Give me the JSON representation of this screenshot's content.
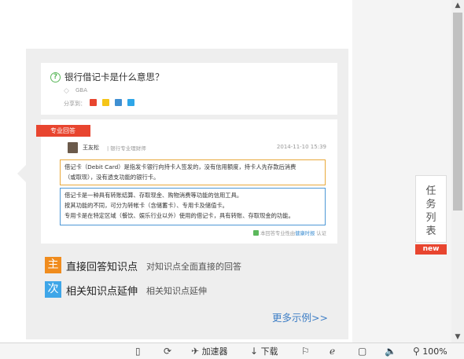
{
  "question": {
    "title": "银行借记卡是什么意思？",
    "tag": "GBA",
    "share_label": "分享到："
  },
  "answer": {
    "badge": "专业回答",
    "expert_name": "王友松",
    "expert_title": "| 银行专业理财师",
    "date": "2014-11-10  15:39",
    "orange_lines": [
      "借记卡（Debit Card）是指发卡银行向持卡人签发的，没有信用额度，持卡人先存款后消费",
      "（或取现），没有透支功能的银行卡。"
    ],
    "blue_lines": [
      "借记卡是一种具有转账结算、存取现金、购物消费等功能的信用工具。",
      "按其功能的不同，可分为转帐卡（含储蓄卡）、专用卡及储值卡。",
      "专用卡是在特定区域（餐饮、娱乐行业以外）使用的借记卡，具有转账、存取现金的功能。"
    ],
    "footer_prefix": "本回答专业性由",
    "footer_brand": "健康时报",
    "footer_suffix": "认证"
  },
  "features": [
    {
      "badge": "主",
      "title": "直接回答知识点",
      "desc": "对知识点全面直接的回答",
      "color": "#f08c1e"
    },
    {
      "badge": "次",
      "title": "相关知识点延伸",
      "desc": "相关知识点延伸",
      "color": "#3ea6e8"
    }
  ],
  "more_link": "更多示例>>",
  "task": {
    "label_chars": [
      "任",
      "务",
      "列",
      "表"
    ],
    "new_badge": "new"
  },
  "scroll": {
    "up": "▲",
    "down": "▼"
  },
  "statusbar": {
    "items": [
      {
        "icon": "mobile-icon",
        "glyph": "▯",
        "label": ""
      },
      {
        "icon": "refresh-icon",
        "glyph": "⟳",
        "label": ""
      },
      {
        "icon": "accelerator-icon",
        "glyph": "✈",
        "label": "加速器"
      },
      {
        "icon": "download-icon",
        "glyph": "↓",
        "label": "下载"
      },
      {
        "icon": "flag-icon",
        "glyph": "⚐",
        "label": ""
      },
      {
        "icon": "ie-icon",
        "glyph": "ℯ",
        "label": ""
      },
      {
        "icon": "window-icon",
        "glyph": "▢",
        "label": ""
      },
      {
        "icon": "sound-icon",
        "glyph": "🔈",
        "label": ""
      },
      {
        "icon": "zoom-icon",
        "glyph": "⚲",
        "label": "100%"
      }
    ]
  }
}
